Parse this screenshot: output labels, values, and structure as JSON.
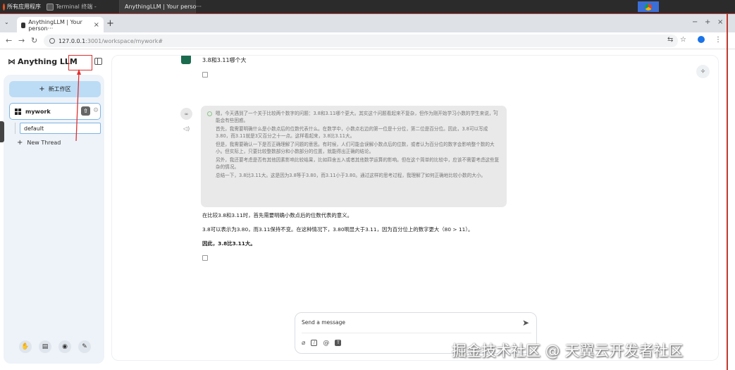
{
  "taskbar": {
    "apps": [
      {
        "label": "所有应用程序",
        "icon": "ubuntu-icon"
      },
      {
        "label": "Terminal 终端 -",
        "icon": "terminal-icon"
      },
      {
        "label": "AnythingLLM | Your perso···",
        "icon": "chrome-icon"
      }
    ]
  },
  "browser": {
    "tab_title": "AnythingLLM | Your person···",
    "url_host": "127.0.0.1",
    "url_path": ":3001/workspace/mywork#"
  },
  "sidebar": {
    "logo": "Anything LLM",
    "new_workspace": "新工作区",
    "workspace": "mywork",
    "thread_default": "default",
    "new_thread": "New Thread"
  },
  "chat": {
    "user_message": "3.8和3.11哪个大",
    "thinking": [
      "嗯，今天遇到了一个关于比较两个数字的问题：3.8和3.11哪个更大。其实这个问题看起来不复杂，但作为刚开始学习小数的学生来说，可能会有些困惑。",
      "首先，我需要明确什么是小数点后的位数代表什么。在数学中，小数点右边的第一位是十分位，第二位是百分位。因此，3.8可以写成3.80，而3.11就是3又百分之十一点。这样看起来，3.8比3.11大。",
      "但是，我需要确认一下是否正确理解了问题的意思。有时候，人们可能会误解小数点后的位数，或者认为百分位的数字会影响整个数的大小。但实际上，只要比较整数部分和小数部分的位置，就能得出正确的结论。",
      "另外，我还要考虑是否有其他因素影响比较结果，比如四舍五入或者其他数学运算的影响。但在这个简单的比较中，应该不需要考虑这些复杂的情况。",
      "总结一下，3.8比3.11大。这是因为3.8等于3.80，而3.11小于3.80。通过这样的思考过程，我理解了如何正确地比较小数的大小。"
    ],
    "answer": [
      "在比较3.8和3.11时，首先需要明确小数点后的位数代表的意义。",
      "3.8可以表示为3.80，而3.11保持不变。在这种情况下，3.80明显大于3.11，因为百分位上的数字更大（80 > 11）。",
      "因此，3.8比3.11大。"
    ]
  },
  "composer": {
    "placeholder": "Send a message"
  },
  "watermark": "掘金技术社区 @ 天翼云开发者社区",
  "colors": {
    "accent": "#bcdcf5",
    "selection_border": "#7eb4e3",
    "annotation_red": "#e03030"
  }
}
